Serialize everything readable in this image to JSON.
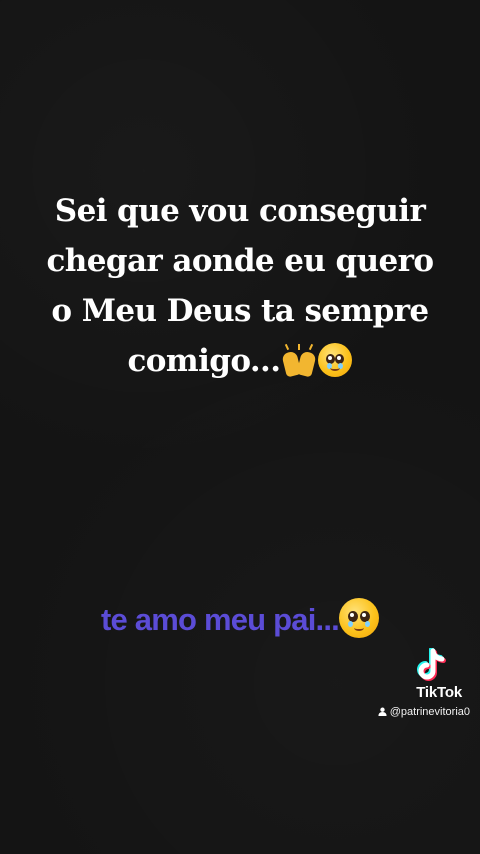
{
  "caption": {
    "lines": [
      "Sei que vou conseguir",
      "chegar aonde eu quero",
      "o Meu Deus ta sempre",
      "comigo..."
    ],
    "emojis": [
      "raised-hands",
      "pleading-face"
    ]
  },
  "subtitle": {
    "text": "te amo meu pai...",
    "emoji": "pleading-face"
  },
  "watermark": {
    "brand": "TikTok",
    "username": "@patrinevitoria0",
    "icons": [
      "tiktok-logo-icon",
      "person-icon"
    ]
  },
  "colors": {
    "background": "#141414",
    "caption_text": "#ffffff",
    "subtitle_text": "#5b4cd6",
    "tiktok_cyan": "#25f4ee",
    "tiktok_red": "#fe2c55"
  }
}
